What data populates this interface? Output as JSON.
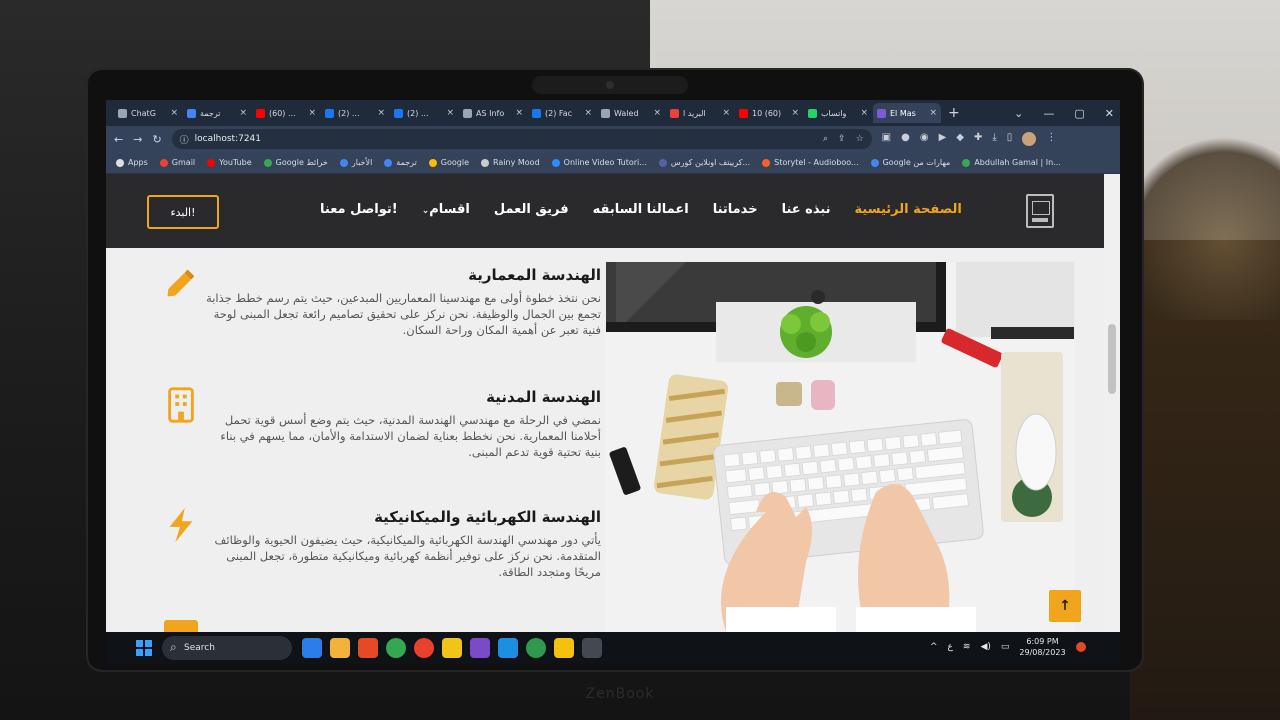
{
  "browser": {
    "tabs": [
      {
        "label": "ChatG",
        "color": "#9aa6b2"
      },
      {
        "label": "ترجمة",
        "color": "#4285f4"
      },
      {
        "label": "(60) ...",
        "color": "#ff0000"
      },
      {
        "label": "(2) ...",
        "color": "#1877f2"
      },
      {
        "label": "(2) ...",
        "color": "#1877f2"
      },
      {
        "label": "AS Info",
        "color": "#9aa6b2"
      },
      {
        "label": "(2) Fac",
        "color": "#1877f2"
      },
      {
        "label": "Waled",
        "color": "#9aa6b2"
      },
      {
        "label": "البريد ا",
        "color": "#ea4335"
      },
      {
        "label": "10 (60)",
        "color": "#ff0000"
      },
      {
        "label": "واتساب",
        "color": "#25d366"
      },
      {
        "label": "El Mas",
        "color": "#7b5cd6",
        "active": true
      }
    ],
    "new_tab": "+",
    "address": "localhost:7241",
    "bookmarks": [
      {
        "label": "Apps",
        "color": "#e0e0e0"
      },
      {
        "label": "Gmail",
        "color": "#ea4335"
      },
      {
        "label": "YouTube",
        "color": "#ff0000"
      },
      {
        "label": "Google خرائط",
        "color": "#34a853"
      },
      {
        "label": "الأخبار",
        "color": "#4285f4"
      },
      {
        "label": "ترجمة",
        "color": "#4285f4"
      },
      {
        "label": "Google",
        "color": "#fbbc05"
      },
      {
        "label": "Rainy Mood",
        "color": "#cccccc"
      },
      {
        "label": "Online Video Tutori...",
        "color": "#2d8cff"
      },
      {
        "label": "كرييتف اونلاين كورس...",
        "color": "#5561a8"
      },
      {
        "label": "Storytel - Audioboo...",
        "color": "#ff5c28"
      },
      {
        "label": "Google مهارات من",
        "color": "#4285f4"
      },
      {
        "label": "Abdullah Gamal | In...",
        "color": "#34a853"
      }
    ]
  },
  "site": {
    "cta": "البدء!",
    "menu": [
      "تواصل معنا!",
      "اقسام",
      "فريق العمل",
      "اعمالنا السابقه",
      "خدماتنا",
      "نبذه عنا",
      "الصفحة الرئيسية"
    ],
    "services": [
      {
        "title": "الهندسة المعمارية",
        "text": "نحن نتخذ خطوة أولى مع مهندسينا المعماريين المبدعين، حيث يتم رسم خطط جذابة تجمع بين الجمال والوظيفة. نحن نركز على تحقيق تصاميم رائعة تجعل المبنى لوحة فنية تعبر عن أهمية المكان وراحة السكان.",
        "icon": "pencil-icon"
      },
      {
        "title": "الهندسة المدنية",
        "text": "نمضي في الرحلة مع مهندسي الهندسة المدنية، حيث يتم وضع أسس قوية تحمل أحلامنا المعمارية. نحن نخطط بعناية لضمان الاستدامة والأمان، مما يسهم في بناء بنية تحتية قوية تدعم المبنى.",
        "icon": "building-icon"
      },
      {
        "title": "الهندسة الكهربائية والميكانيكية",
        "text": "يأتي دور مهندسي الهندسة الكهربائية والميكانيكية، حيث يضيفون الحيوية والوظائف المتقدمة. نحن نركز على توفير أنظمة كهربائية وميكانيكية متطورة، تجعل المبنى مريحًا ومتجدد الطاقة.",
        "icon": "bolt-icon"
      }
    ],
    "back_to_top": "↑"
  },
  "taskbar": {
    "search": "Search",
    "time": "6:09 PM",
    "date": "29/08/2023",
    "lang": "ع"
  },
  "accent_color": "#f1a51c"
}
